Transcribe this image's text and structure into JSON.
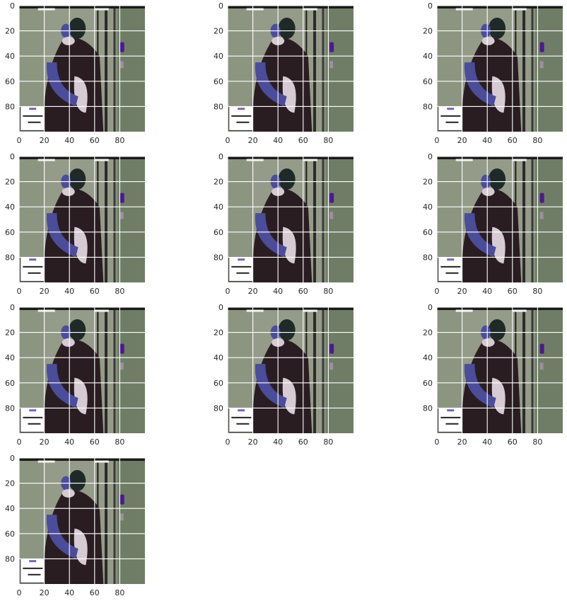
{
  "chart_data": {
    "type": "image-grid",
    "grid": {
      "rows": 4,
      "cols": 3
    },
    "panel_count": 10,
    "image_extent": {
      "x": [
        0,
        100
      ],
      "y": [
        0,
        100
      ]
    },
    "x_ticks": [
      "0",
      "20",
      "40",
      "60",
      "80"
    ],
    "y_ticks": [
      "0",
      "20",
      "40",
      "60",
      "80"
    ],
    "grid_lines": true,
    "grid_color": "#ffffff",
    "panels": [
      {
        "variant": 0
      },
      {
        "variant": 1
      },
      {
        "variant": 2
      },
      {
        "variant": 3
      },
      {
        "variant": 4
      },
      {
        "variant": 5
      },
      {
        "variant": 6
      },
      {
        "variant": 7
      },
      {
        "variant": 8
      },
      {
        "variant": 9
      }
    ],
    "image_content": {
      "scene": "two people embracing in a hallway, overlaid sign at lower-left",
      "colors": {
        "background_left": "#8c9580",
        "background_right": "#6f7d66",
        "door_frame": "#2b2b2b",
        "coat": "#2a1d22",
        "arm_sleeve": "#4b4d9a",
        "light_sleeve": "#d6cbd3",
        "head": "#1f2a28",
        "sign_purple": "#4b1a8f",
        "sign_card": "#ffffff"
      }
    }
  }
}
